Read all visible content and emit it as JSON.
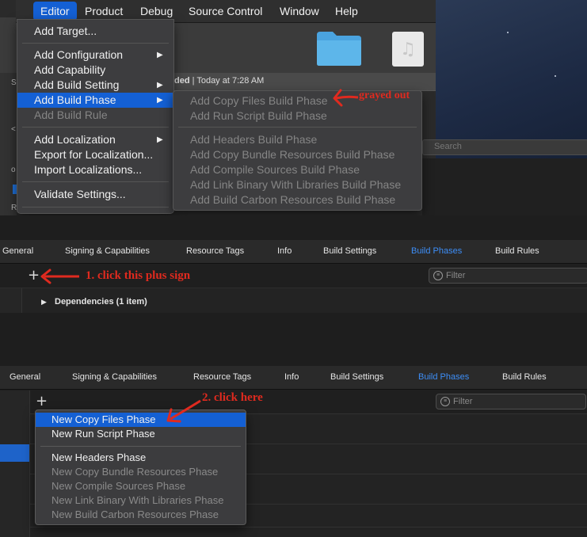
{
  "menubar": {
    "items": [
      "Editor",
      "Product",
      "Debug",
      "Source Control",
      "Window",
      "Help"
    ]
  },
  "editor_menu": {
    "items": [
      {
        "label": "Add Target...",
        "submenu": false,
        "disabled": false,
        "highlighted": false
      },
      {
        "label": "Add Configuration",
        "submenu": true,
        "disabled": false,
        "highlighted": false
      },
      {
        "label": "Add Capability",
        "submenu": false,
        "disabled": false,
        "highlighted": false
      },
      {
        "label": "Add Build Setting",
        "submenu": true,
        "disabled": false,
        "highlighted": false
      },
      {
        "label": "Add Build Phase",
        "submenu": true,
        "disabled": false,
        "highlighted": true
      },
      {
        "label": "Add Build Rule",
        "submenu": false,
        "disabled": true,
        "highlighted": false
      },
      {
        "label": "Add Localization",
        "submenu": true,
        "disabled": false,
        "highlighted": false
      },
      {
        "label": "Export for Localization...",
        "submenu": false,
        "disabled": false,
        "highlighted": false
      },
      {
        "label": "Import Localizations...",
        "submenu": false,
        "disabled": false,
        "highlighted": false
      },
      {
        "label": "Validate Settings...",
        "submenu": false,
        "disabled": false,
        "highlighted": false
      }
    ]
  },
  "build_phase_submenu": {
    "items": [
      "Add Copy Files Build Phase",
      "Add Run Script Build Phase",
      "Add Headers Build Phase",
      "Add Copy Bundle Resources Build Phase",
      "Add Compile Sources Build Phase",
      "Add Link Binary With Libraries Build Phase",
      "Add Build Carbon Resources Build Phase"
    ]
  },
  "status_bar": {
    "prefix": "ded",
    "time": " | Today at 7:28 AM"
  },
  "window_search_placeholder": "Search",
  "annotations": {
    "grayed_out": "grayed out",
    "step1": "1. click this plus sign",
    "step2": "2. click here"
  },
  "tabs": [
    "General",
    "Signing & Capabilities",
    "Resource Tags",
    "Info",
    "Build Settings",
    "Build Phases",
    "Build Rules"
  ],
  "active_tab": "Build Phases",
  "filter_placeholder": "Filter",
  "plus_label": "+",
  "dependencies_label": "Dependencies (1 item)",
  "new_phase_popup": {
    "items": [
      {
        "label": "New Copy Files Phase",
        "disabled": false,
        "highlighted": true
      },
      {
        "label": "New Run Script Phase",
        "disabled": false,
        "highlighted": false
      },
      {
        "label": "New Headers Phase",
        "disabled": false,
        "highlighted": false
      },
      {
        "label": "New Copy Bundle Resources Phase",
        "disabled": true,
        "highlighted": false
      },
      {
        "label": "New Compile Sources Phase",
        "disabled": true,
        "highlighted": false
      },
      {
        "label": "New Link Binary With Libraries Phase",
        "disabled": true,
        "highlighted": false
      },
      {
        "label": "New Build Carbon Resources Phase",
        "disabled": true,
        "highlighted": false
      }
    ]
  },
  "colors": {
    "accent": "#1460d4",
    "active_tab": "#3d8ef7",
    "annotation": "#e02a1f"
  },
  "icons": [
    "folder-icon",
    "music-icon",
    "chevron-right-icon",
    "plus-icon",
    "filter-icon",
    "disclosure-triangle-icon",
    "arrow-annotation-icon"
  ]
}
